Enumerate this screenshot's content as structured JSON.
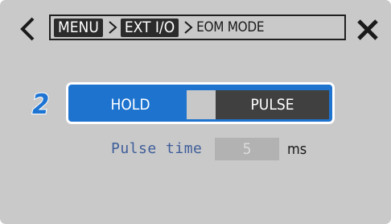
{
  "header": {
    "back_icon": "chevron-left-icon",
    "breadcrumb": {
      "menu_label": "MENU",
      "ext_io_label": "EXT I/O",
      "current_label": "EOM MODE",
      "separator_icon": "chevron-right-icon"
    },
    "close_icon": "close-icon"
  },
  "step_number": "2",
  "mode_selector": {
    "options": [
      "HOLD",
      "PULSE"
    ],
    "selected": "HOLD",
    "accent_color": "#1e73cf"
  },
  "pulse_time": {
    "label": "Pulse time",
    "value": "5",
    "unit": "ms",
    "disabled": true
  }
}
